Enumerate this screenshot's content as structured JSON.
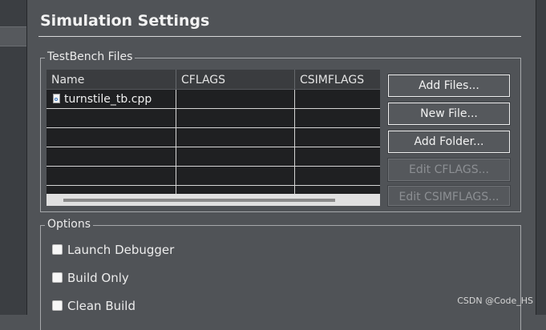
{
  "header": {
    "title": "Simulation Settings"
  },
  "testbench": {
    "legend": "TestBench Files",
    "columns": [
      "Name",
      "CFLAGS",
      "CSIMFLAGS"
    ],
    "files": [
      {
        "name": "turnstile_tb.cpp",
        "cflags": "",
        "csimflags": ""
      }
    ],
    "buttons": {
      "add_files": "Add Files...",
      "new_file": "New File...",
      "add_folder": "Add Folder...",
      "edit_cflags": "Edit CFLAGS...",
      "edit_csimflags": "Edit CSIMFLAGS..."
    }
  },
  "options": {
    "legend": "Options",
    "items": [
      {
        "label": "Launch Debugger",
        "checked": false
      },
      {
        "label": "Build Only",
        "checked": false
      },
      {
        "label": "Clean Build",
        "checked": false
      }
    ]
  },
  "watermark": "CSDN @Code_HS",
  "colors": {
    "background": "#505357",
    "table_background": "#1f2022",
    "disabled_text": "#8c8f93"
  }
}
